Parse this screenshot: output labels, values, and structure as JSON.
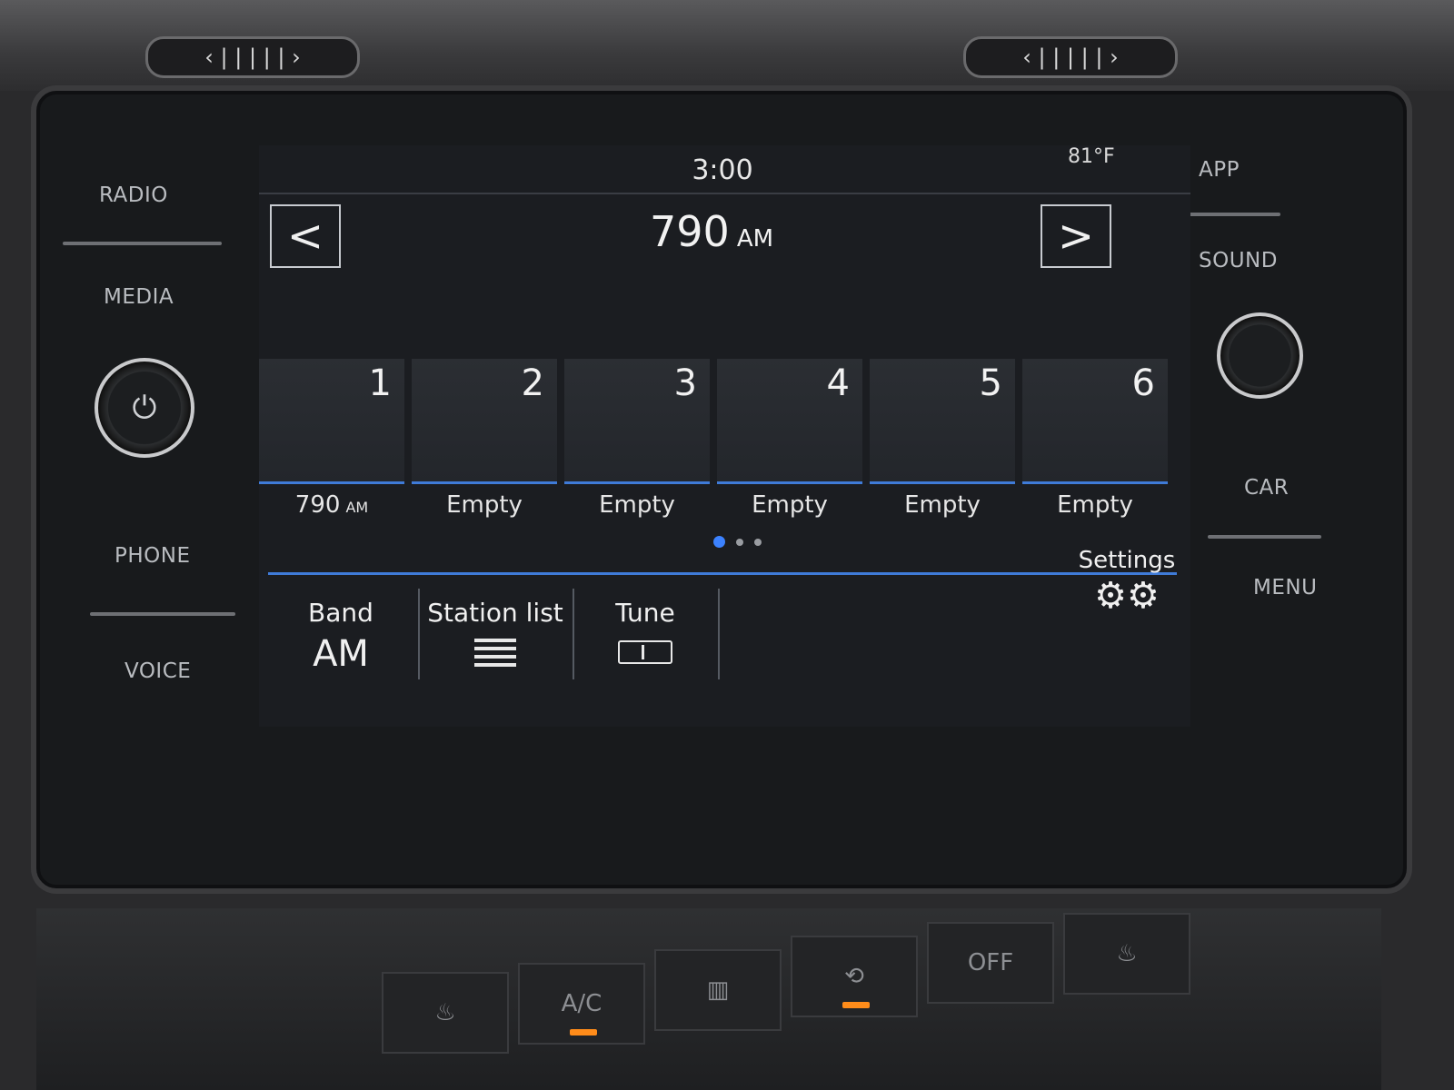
{
  "status": {
    "time": "3:00",
    "temperature": "81°F"
  },
  "side_keys_left": [
    "RADIO",
    "MEDIA",
    "PHONE",
    "VOICE"
  ],
  "side_keys_right": [
    "APP",
    "SOUND",
    "CAR",
    "MENU"
  ],
  "station": {
    "frequency": "790",
    "band_unit": "AM"
  },
  "presets": [
    {
      "number": "1",
      "label": "790",
      "label_unit": "AM"
    },
    {
      "number": "2",
      "label": "Empty"
    },
    {
      "number": "3",
      "label": "Empty"
    },
    {
      "number": "4",
      "label": "Empty"
    },
    {
      "number": "5",
      "label": "Empty"
    },
    {
      "number": "6",
      "label": "Empty"
    }
  ],
  "pager": {
    "pages": 3,
    "active": 1
  },
  "bottom": {
    "band_label": "Band",
    "band_value": "AM",
    "station_list_label": "Station list",
    "tune_label": "Tune",
    "settings_label": "Settings"
  },
  "climate": {
    "ac_label": "A/C",
    "off_label": "OFF"
  },
  "colors": {
    "accent": "#3f7bd8",
    "indicator": "#ff8c1a"
  }
}
